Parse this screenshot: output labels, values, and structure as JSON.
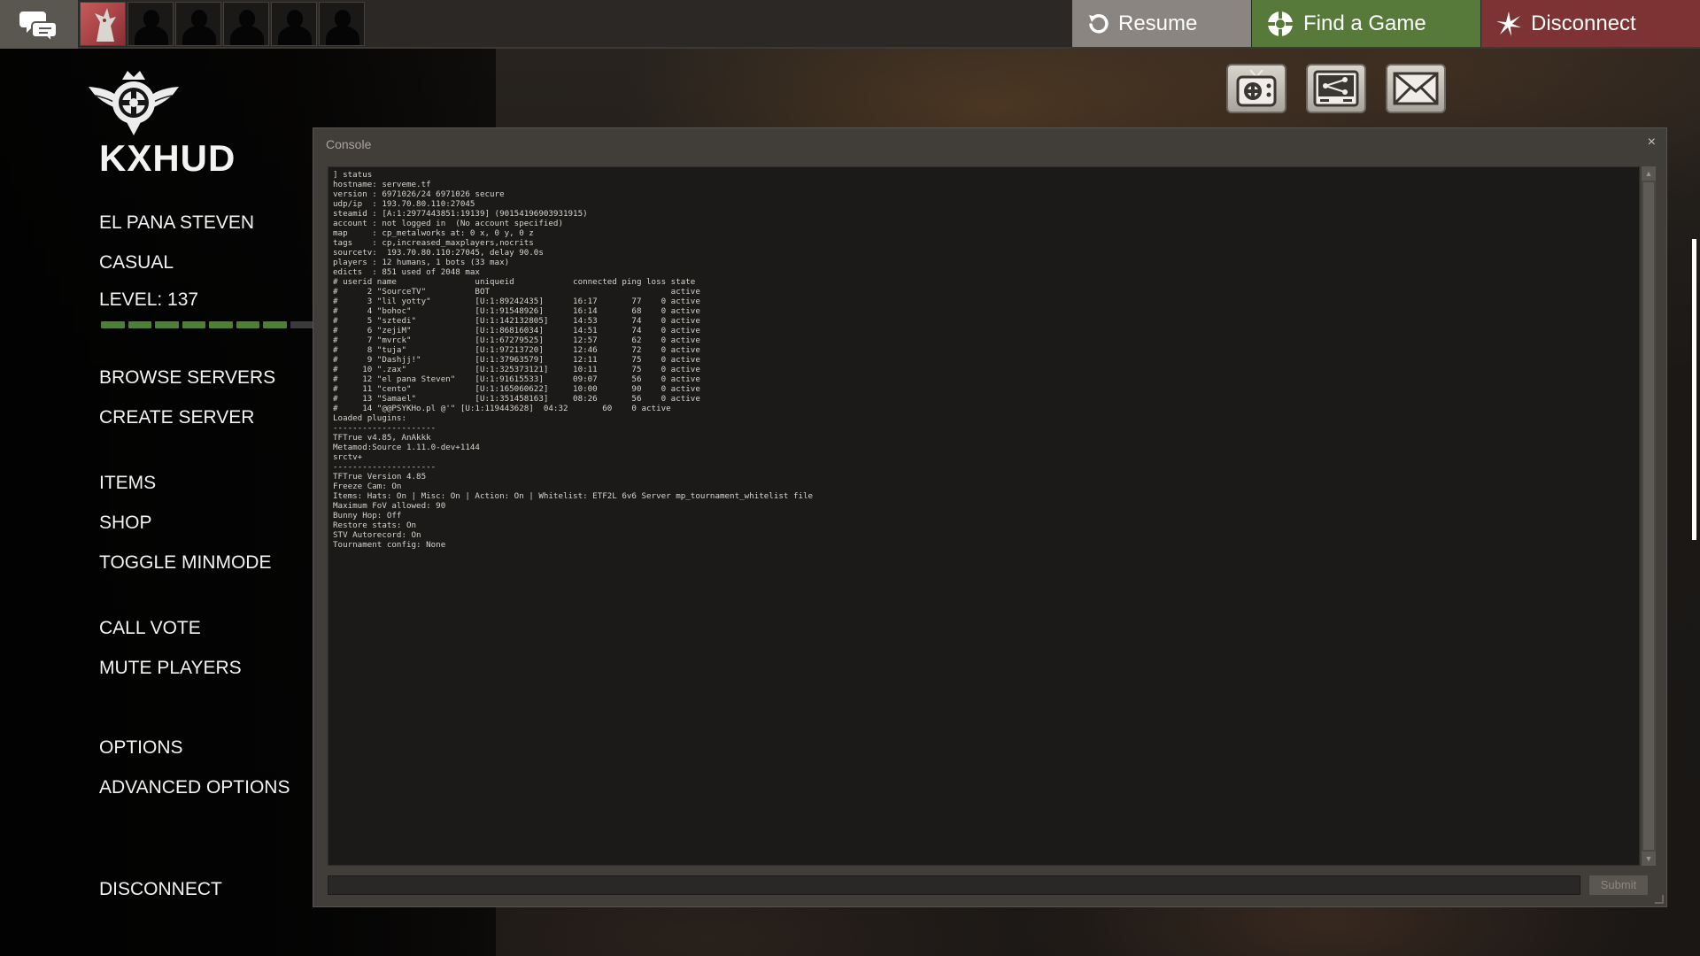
{
  "topbar": {
    "chat_icon": "chat-bubbles-icon",
    "party_slots": 6,
    "resume_label": "Resume",
    "find_game_label": "Find a Game",
    "disconnect_label": "Disconnect",
    "colors": {
      "resume": "#8a8580",
      "find_game": "#577a3a",
      "disconnect": "#7d3333"
    }
  },
  "sidebar": {
    "hud_name": "KXHUD",
    "player_name": "EL PANA STEVEN",
    "mode": "CASUAL",
    "level": "LEVEL: 137",
    "level_progress_segments_filled": 7,
    "level_progress_segments_total": 8,
    "menu": {
      "browse_servers": "BROWSE SERVERS",
      "create_server": "CREATE SERVER",
      "items": "ITEMS",
      "shop": "SHOP",
      "toggle_minmode": "TOGGLE MINMODE",
      "call_vote": "CALL VOTE",
      "mute_players": "MUTE PLAYERS",
      "options": "OPTIONS",
      "advanced_options": "ADVANCED OPTIONS",
      "disconnect": "DISCONNECT"
    }
  },
  "corner_icons": [
    "tv-icon",
    "network-icon",
    "mail-icon"
  ],
  "console": {
    "title": "Console",
    "close_label": "×",
    "submit_label": "Submit",
    "input_value": "",
    "output": "] status\nhostname: serveme.tf\nversion : 6971026/24 6971026 secure\nudp/ip  : 193.70.80.110:27045\nsteamid : [A:1:2977443851:19139] (90154196903931915)\naccount : not logged in  (No account specified)\nmap     : cp_metalworks at: 0 x, 0 y, 0 z\ntags    : cp,increased_maxplayers,nocrits\nsourcetv:  193.70.80.110:27045, delay 90.0s\nplayers : 12 humans, 1 bots (33 max)\nedicts  : 851 used of 2048 max\n# userid name                uniqueid            connected ping loss state\n#      2 \"SourceTV\"          BOT                                     active\n#      3 \"lil yotty\"         [U:1:89242435]      16:17       77    0 active\n#      4 \"bohoc\"             [U:1:91548926]      16:14       68    0 active\n#      5 \"sztedi\"            [U:1:142132805]     14:53       74    0 active\n#      6 \"zejiM\"             [U:1:86816034]      14:51       74    0 active\n#      7 \"mvrck\"             [U:1:67279525]      12:57       62    0 active\n#      8 \"tuja\"              [U:1:97213720]      12:46       72    0 active\n#      9 \"Dashjj!\"           [U:1:37963579]      12:11       75    0 active\n#     10 \".zax\"              [U:1:325373121]     10:11       75    0 active\n#     12 \"el pana Steven\"    [U:1:91615533]      09:07       56    0 active\n#     11 \"cento\"             [U:1:165060622]     10:00       90    0 active\n#     13 \"Samael\"            [U:1:351458163]     08:26       56    0 active\n#     14 \"@@PSYKHo.pl @'\" [U:1:119443628]  04:32       60    0 active\nLoaded plugins:\n---------------------\nTFTrue v4.85, AnAkkk\nMetamod:Source 1.11.0-dev+1144\nsrctv+\n---------------------\nTFTrue Version 4.85\nFreeze Cam: On\nItems: Hats: On | Misc: On | Action: On | Whitelist: ETF2L 6v6 Server mp_tournament_whitelist file\nMaximum FoV allowed: 90\nBunny Hop: Off\nRestore stats: On\nSTV Autorecord: On\nTournament config: None"
  }
}
